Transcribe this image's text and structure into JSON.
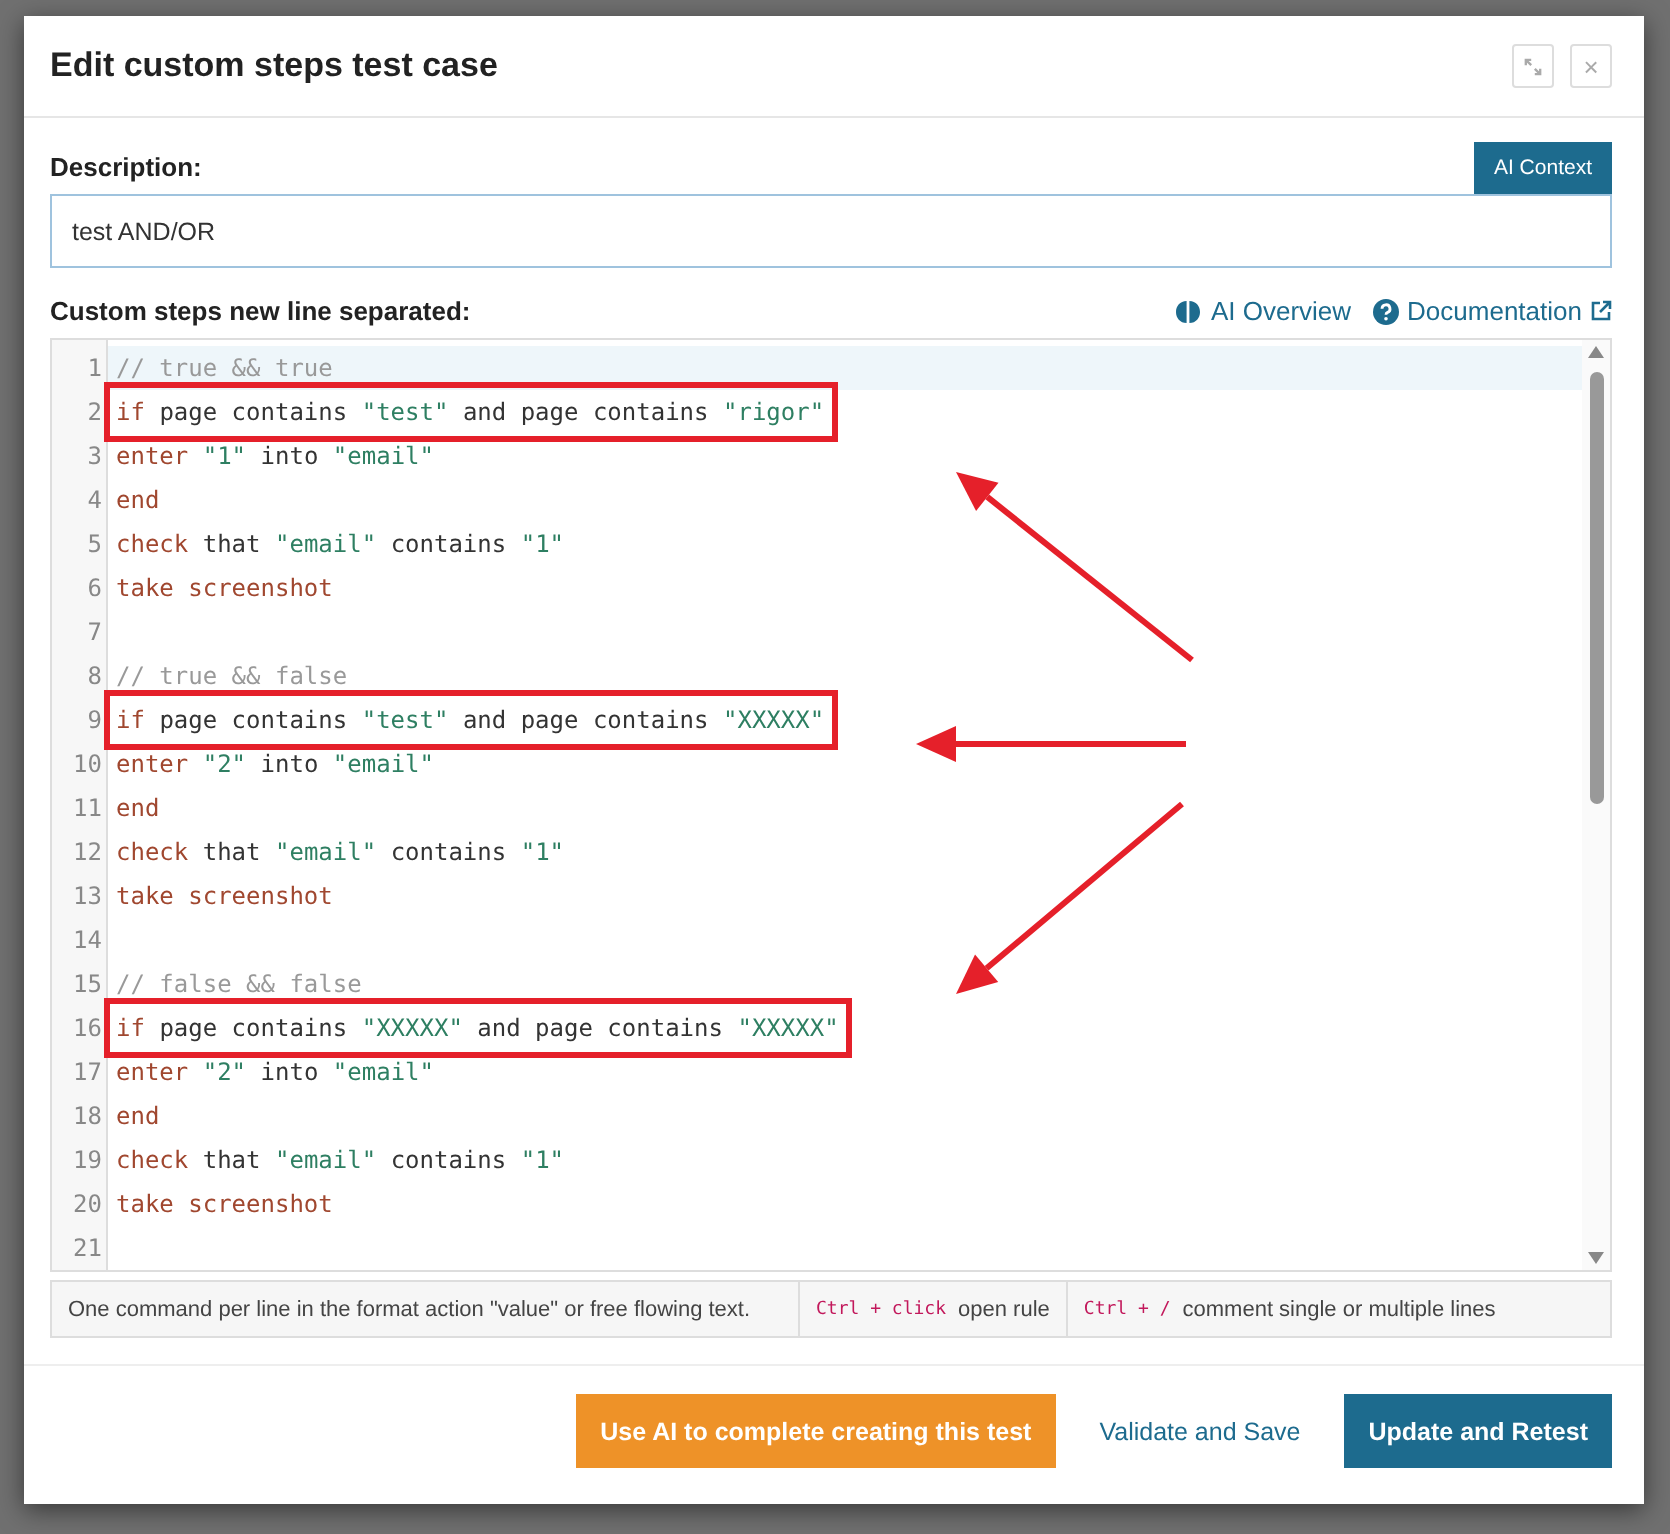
{
  "dialog": {
    "title": "Edit custom steps test case",
    "header_buttons": [
      {
        "kind": "expand"
      },
      {
        "kind": "close",
        "label": "×"
      }
    ]
  },
  "description": {
    "label": "Description:",
    "ai_context_button": "AI Context",
    "value": "test AND/OR"
  },
  "steps": {
    "label": "Custom steps new line separated:",
    "links": [
      {
        "kind": "brain",
        "label": "AI Overview",
        "external": false
      },
      {
        "kind": "help",
        "label": "Documentation",
        "external": true
      }
    ],
    "lines": [
      {
        "number": "1",
        "active": true,
        "boxed": false,
        "tokens": [
          {
            "kind": "comment",
            "text": "// true && true"
          }
        ]
      },
      {
        "number": "2",
        "active": false,
        "boxed": true,
        "tokens": [
          {
            "kind": "keyword",
            "text": "if"
          },
          {
            "kind": "plain",
            "text": "page contains"
          },
          {
            "kind": "string",
            "text": "\"test\""
          },
          {
            "kind": "plain",
            "text": "and page contains"
          },
          {
            "kind": "string",
            "text": "\"rigor\""
          }
        ]
      },
      {
        "number": "3",
        "active": false,
        "boxed": false,
        "tokens": [
          {
            "kind": "keyword",
            "text": "enter"
          },
          {
            "kind": "string",
            "text": "\"1\""
          },
          {
            "kind": "plain",
            "text": "into"
          },
          {
            "kind": "string",
            "text": "\"email\""
          }
        ]
      },
      {
        "number": "4",
        "active": false,
        "boxed": false,
        "tokens": [
          {
            "kind": "keyword",
            "text": "end"
          }
        ]
      },
      {
        "number": "5",
        "active": false,
        "boxed": false,
        "tokens": [
          {
            "kind": "keyword",
            "text": "check"
          },
          {
            "kind": "plain",
            "text": "that"
          },
          {
            "kind": "string",
            "text": "\"email\""
          },
          {
            "kind": "plain",
            "text": "contains"
          },
          {
            "kind": "string",
            "text": "\"1\""
          }
        ]
      },
      {
        "number": "6",
        "active": false,
        "boxed": false,
        "tokens": [
          {
            "kind": "keyword",
            "text": "take screenshot"
          }
        ]
      },
      {
        "number": "7",
        "active": false
      },
      {
        "number": "8",
        "active": false,
        "boxed": false,
        "tokens": [
          {
            "kind": "comment",
            "text": "// true && false"
          }
        ]
      },
      {
        "number": "9",
        "active": false,
        "boxed": true,
        "tokens": [
          {
            "kind": "keyword",
            "text": "if"
          },
          {
            "kind": "plain",
            "text": "page contains"
          },
          {
            "kind": "string",
            "text": "\"test\""
          },
          {
            "kind": "plain",
            "text": "and page contains"
          },
          {
            "kind": "string",
            "text": "\"XXXXX\""
          }
        ]
      },
      {
        "number": "10",
        "active": false,
        "boxed": false,
        "tokens": [
          {
            "kind": "keyword",
            "text": "enter"
          },
          {
            "kind": "string",
            "text": "\"2\""
          },
          {
            "kind": "plain",
            "text": "into"
          },
          {
            "kind": "string",
            "text": "\"email\""
          }
        ]
      },
      {
        "number": "11",
        "active": false,
        "boxed": false,
        "tokens": [
          {
            "kind": "keyword",
            "text": "end"
          }
        ]
      },
      {
        "number": "12",
        "active": false,
        "boxed": false,
        "tokens": [
          {
            "kind": "keyword",
            "text": "check"
          },
          {
            "kind": "plain",
            "text": "that"
          },
          {
            "kind": "string",
            "text": "\"email\""
          },
          {
            "kind": "plain",
            "text": "contains"
          },
          {
            "kind": "string",
            "text": "\"1\""
          }
        ]
      },
      {
        "number": "13",
        "active": false,
        "boxed": false,
        "tokens": [
          {
            "kind": "keyword",
            "text": "take screenshot"
          }
        ]
      },
      {
        "number": "14",
        "active": false
      },
      {
        "number": "15",
        "active": false,
        "boxed": false,
        "tokens": [
          {
            "kind": "comment",
            "text": "// false && false"
          }
        ]
      },
      {
        "number": "16",
        "active": false,
        "boxed": true,
        "tokens": [
          {
            "kind": "keyword",
            "text": "if"
          },
          {
            "kind": "plain",
            "text": "page contains"
          },
          {
            "kind": "string",
            "text": "\"XXXXX\""
          },
          {
            "kind": "plain",
            "text": "and page contains"
          },
          {
            "kind": "string",
            "text": "\"XXXXX\""
          }
        ]
      },
      {
        "number": "17",
        "active": false,
        "boxed": false,
        "tokens": [
          {
            "kind": "keyword",
            "text": "enter"
          },
          {
            "kind": "string",
            "text": "\"2\""
          },
          {
            "kind": "plain",
            "text": "into"
          },
          {
            "kind": "string",
            "text": "\"email\""
          }
        ]
      },
      {
        "number": "18",
        "active": false,
        "boxed": false,
        "tokens": [
          {
            "kind": "keyword",
            "text": "end"
          }
        ]
      },
      {
        "number": "19",
        "active": false,
        "boxed": false,
        "tokens": [
          {
            "kind": "keyword",
            "text": "check"
          },
          {
            "kind": "plain",
            "text": "that"
          },
          {
            "kind": "string",
            "text": "\"email\""
          },
          {
            "kind": "plain",
            "text": "contains"
          },
          {
            "kind": "string",
            "text": "\"1\""
          }
        ]
      },
      {
        "number": "20",
        "active": false,
        "boxed": false,
        "tokens": [
          {
            "kind": "keyword",
            "text": "take screenshot"
          }
        ]
      },
      {
        "number": "21",
        "active": false
      }
    ],
    "hints": [
      {
        "text": "One command per line in the format action \"value\" or free flowing text."
      },
      {
        "keys": "Ctrl + click",
        "text": "open rule"
      },
      {
        "keys": "Ctrl + /",
        "text": "comment single or multiple lines"
      }
    ]
  },
  "footer_buttons": [
    {
      "kind": "accent",
      "label": "Use AI to complete creating this test"
    },
    {
      "kind": "link",
      "label": "Validate and Save"
    },
    {
      "kind": "primary",
      "label": "Update and Retest"
    }
  ]
}
